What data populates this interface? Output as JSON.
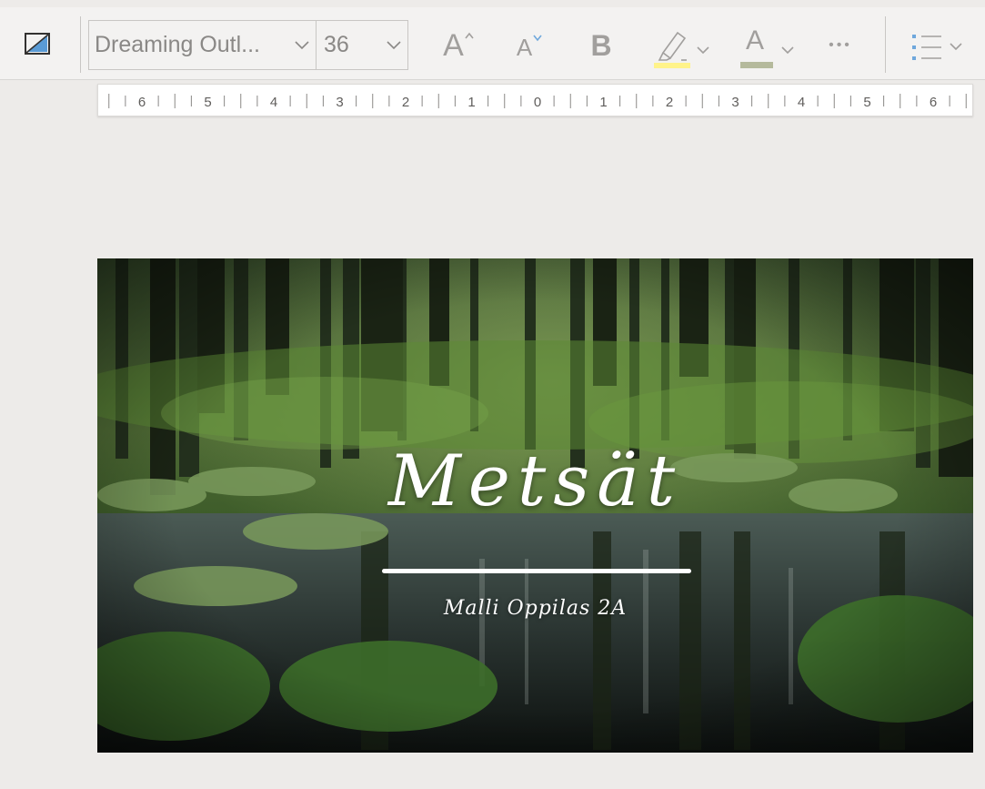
{
  "toolbar": {
    "shape_icon": "shape-fill-icon",
    "font_name": "Dreaming Outl...",
    "font_size": "36",
    "grow_font_glyph": "A",
    "shrink_font_glyph": "A",
    "bold_glyph": "B",
    "font_color_glyph": "A",
    "more_glyph": "•••",
    "highlight_color": "#fff38a",
    "font_color": "#b5ba9c"
  },
  "ruler": {
    "labels": [
      "6",
      "5",
      "4",
      "3",
      "2",
      "1",
      "0",
      "1",
      "2",
      "3",
      "4",
      "5",
      "6"
    ]
  },
  "slide": {
    "title": "Metsät",
    "subtitle": "Malli Oppilas 2A"
  }
}
